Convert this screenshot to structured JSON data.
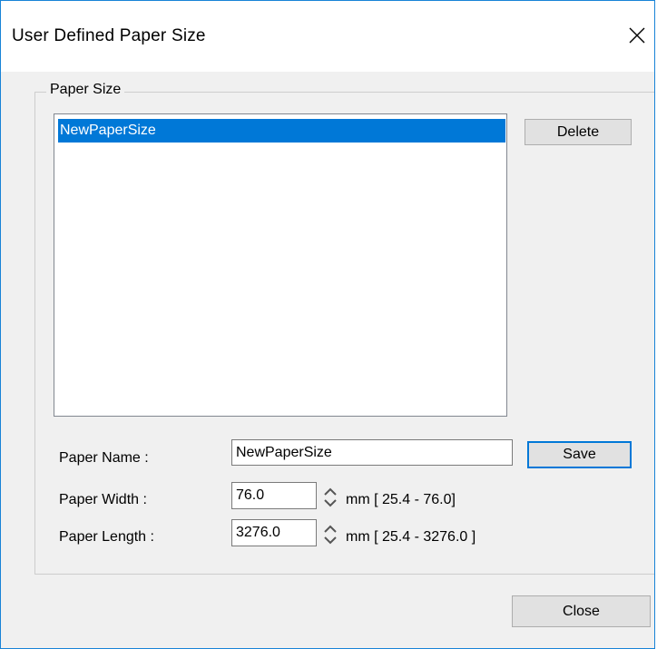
{
  "window": {
    "title": "User Defined Paper Size",
    "close_glyph": "×"
  },
  "paper_size_group": {
    "legend": "Paper Size",
    "list_items": [
      "NewPaperSize"
    ],
    "selected_index": 0,
    "delete_label": "Delete"
  },
  "form": {
    "paper_name_label": "Paper Name :",
    "paper_name_value": "NewPaperSize",
    "save_label": "Save",
    "paper_width_label": "Paper Width :",
    "paper_width_value": "76.0",
    "paper_width_range": "mm [ 25.4 - 76.0]",
    "paper_length_label": "Paper Length :",
    "paper_length_value": "3276.0",
    "paper_length_range": "mm [ 25.4 - 3276.0 ]"
  },
  "footer": {
    "close_label": "Close"
  },
  "colors": {
    "accent": "#0078d7",
    "window_border": "#1883d7",
    "dialog_bg": "#f0f0f0",
    "button_bg": "#e1e1e1"
  },
  "icons": {
    "title_close": "close-icon",
    "spinner": "spinner-arrows-icon"
  }
}
